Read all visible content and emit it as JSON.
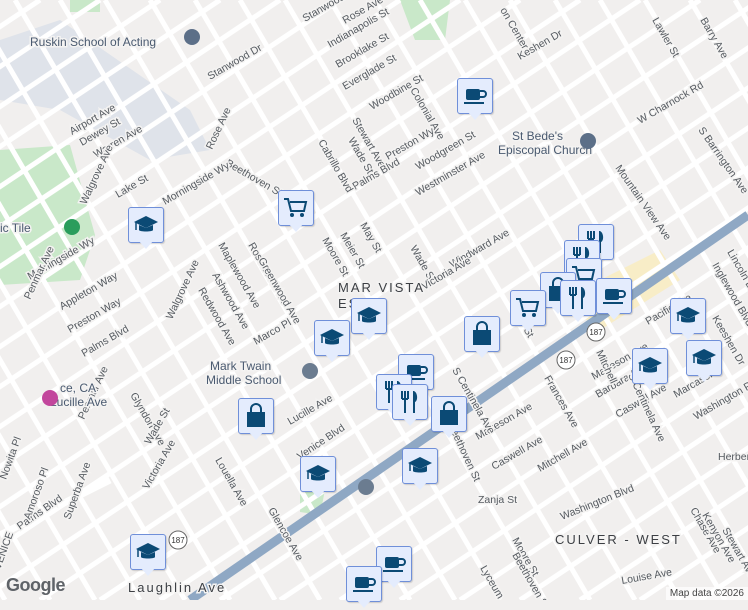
{
  "labels": [
    "Ruskin School of Acting",
    "Stanwood Pl",
    "Rose Ave",
    "Indianapolis St",
    "Brooklake St",
    "Everglade St",
    "Woodbine St",
    "Colonial Ave",
    "Stanwood Dr",
    "Airport Ave",
    "Dewey St",
    "Warren Ave",
    "Rose Ave",
    "Beethoven St",
    "Walgrove Ave",
    "Lake St",
    "Morningside Wy",
    "Preston Wy",
    "Stewart Ave",
    "Wade St",
    "Palms Blvd",
    "Woodgreen St",
    "Westminster Ave",
    "St Bede's",
    "Episcopal Church",
    "W Charnock Rd",
    "Mountain View Ave",
    "S Barrington Ave",
    "Cabrillo Blvd",
    "Moore St",
    "Meier St",
    "May St",
    "Wade St",
    "Windward Ave",
    "Victoria Ave",
    "MAR VISTA",
    "ES",
    "Morningside Wy",
    "Appleton Way",
    "Preston Way",
    "Palms Blvd",
    "Penmar Ave",
    "Penmar Ave",
    "Walgrove Ave",
    "Maplewood Ave",
    "Ashwood Ave",
    "Redwood Ave",
    "Rosewood Ave",
    "Greenwood Ave",
    "Marco Pl",
    "Mark Twain",
    "Middle School",
    "Lucille Ave",
    "Glyndon Ave",
    "Victoria Ave",
    "Louella Ave",
    "Glencoe Ave",
    "Venice Blvd",
    "Beethoven St",
    "Matteson Ave",
    "Caswell Ave",
    "Zanja St",
    "Mitchell Ave",
    "Washington Blvd",
    "Frances Ave",
    "Matteson Ave",
    "Barbara Ave",
    "Caswell Ave",
    "S Centinela Ave",
    "Washington Pl",
    "Herbert St",
    "CULVER - WEST",
    "Chase Ave",
    "Kenyon Ave",
    "Stewart Ave",
    "Louise Ave",
    "Moore St",
    "Beethoven St",
    "Lyceum",
    "Pacific Ave",
    "Keeshen Dr",
    "Inglewood Blvd",
    "Lincoln Blvd",
    "Palms Blvd",
    "Nowita Pl",
    "Amoroso Pl",
    "Superba Ave",
    "VENICE",
    "Laughlin Ave",
    "Barry Ave",
    "Lawler St",
    "Keshen Dr",
    "on Center",
    "ic Tile",
    "ce, CA",
    "Lucille Ave",
    "Wade St",
    "May St",
    "S Centinela Ave",
    "Mitchell",
    "Marcasel"
  ],
  "shields": [
    "187",
    "187",
    "187"
  ],
  "markers": [
    {
      "icon": "cup-icon"
    },
    {
      "icon": "cart-icon"
    },
    {
      "icon": "school-icon"
    },
    {
      "icon": "school-icon"
    },
    {
      "icon": "school-icon"
    },
    {
      "icon": "bag-icon"
    },
    {
      "icon": "fork-knife-icon"
    },
    {
      "icon": "fork-knife-icon"
    },
    {
      "icon": "cart-icon"
    },
    {
      "icon": "bag-icon"
    },
    {
      "icon": "cart-icon"
    },
    {
      "icon": "fork-knife-icon"
    },
    {
      "icon": "cup-icon"
    },
    {
      "icon": "school-icon"
    },
    {
      "icon": "school-icon"
    },
    {
      "icon": "school-icon"
    },
    {
      "icon": "cup-icon"
    },
    {
      "icon": "fork-knife-icon"
    },
    {
      "icon": "fork-knife-icon"
    },
    {
      "icon": "bag-icon"
    },
    {
      "icon": "bag-icon"
    },
    {
      "icon": "school-icon"
    },
    {
      "icon": "school-icon"
    },
    {
      "icon": "school-icon"
    },
    {
      "icon": "cup-icon"
    },
    {
      "icon": "cup-icon"
    }
  ],
  "footer": {
    "logo": "Google",
    "attribution": "Map data ©2026"
  },
  "colors": {
    "background": "#f1efee",
    "road": "#ffffff",
    "major_road": "#8fa8c4",
    "park": "#c9e8c9",
    "commercial": "#f8edc7",
    "marker_bg": "#e4ecfd",
    "marker_icon": "#0b4a75"
  }
}
